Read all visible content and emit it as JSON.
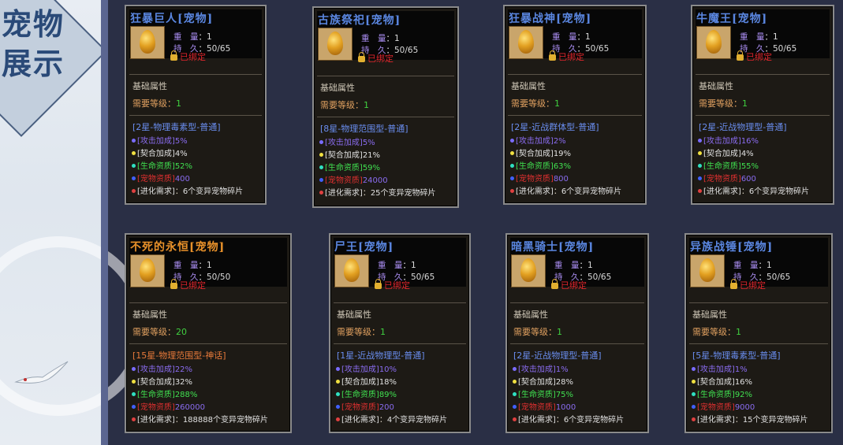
{
  "banner": {
    "line1": "宠物",
    "line2": "展示"
  },
  "labels": {
    "weight": "重　量",
    "durability": "持　久",
    "bound": "已绑定",
    "basic_attr": "基础属性",
    "req_level": "需要等级",
    "attack_bonus": "[攻击加成]",
    "contract_bonus": "[契合加成]",
    "life_quality": "[生命资质]",
    "pet_quality": "[宠物资质]",
    "evolve_need": "[进化需求]"
  },
  "pets": [
    {
      "name": "狂暴巨人[宠物]",
      "weight": "1",
      "durability": "50/65",
      "bound": true,
      "req_level": "1",
      "type": "[2星-物理毒素型-普通]",
      "attack": "5%",
      "contract": "4%",
      "life": "52%",
      "quality": "400",
      "evolve": "6个变异宠物碎片"
    },
    {
      "name": "古族祭祀[宠物]",
      "weight": "1",
      "durability": "50/65",
      "bound": true,
      "req_level": "1",
      "type": "[8星-物理范围型-普通]",
      "attack": "5%",
      "contract": "21%",
      "life": "59%",
      "quality": "24000",
      "evolve": "25个变异宠物碎片"
    },
    {
      "name": "狂暴战神[宠物]",
      "weight": "1",
      "durability": "50/65",
      "bound": true,
      "req_level": "1",
      "type": "[2星-近战群体型-普通]",
      "attack": "2%",
      "contract": "19%",
      "life": "63%",
      "quality": "800",
      "evolve": "6个变异宠物碎片"
    },
    {
      "name": "牛魔王[宠物]",
      "weight": "1",
      "durability": "50/65",
      "bound": true,
      "req_level": "1",
      "type": "[2星-近战物理型-普通]",
      "attack": "16%",
      "contract": "4%",
      "life": "55%",
      "quality": "600",
      "evolve": "6个变异宠物碎片"
    },
    {
      "name": "不死的永恒[宠物]",
      "weight": "1",
      "durability": "50/50",
      "bound": true,
      "req_level": "20",
      "type": "[15星-物理范围型-神话]",
      "attack": "22%",
      "contract": "32%",
      "life": "288%",
      "quality": "260000",
      "evolve": "188888个变异宠物碎片"
    },
    {
      "name": "尸王[宠物]",
      "weight": "1",
      "durability": "50/65",
      "bound": true,
      "req_level": "1",
      "type": "[1星-近战物理型-普通]",
      "attack": "10%",
      "contract": "18%",
      "life": "89%",
      "quality": "200",
      "evolve": "4个变异宠物碎片"
    },
    {
      "name": "暗黑骑士[宠物]",
      "weight": "1",
      "durability": "50/65",
      "bound": true,
      "req_level": "1",
      "type": "[2星-近战物理型-普通]",
      "attack": "1%",
      "contract": "28%",
      "life": "75%",
      "quality": "1000",
      "evolve": "6个变异宠物碎片"
    },
    {
      "name": "异族战锤[宠物]",
      "weight": "1",
      "durability": "50/65",
      "bound": true,
      "req_level": "1",
      "type": "[5星-物理毒素型-普通]",
      "attack": "1%",
      "contract": "16%",
      "life": "92%",
      "quality": "9000",
      "evolve": "15个变异宠物碎片"
    }
  ]
}
